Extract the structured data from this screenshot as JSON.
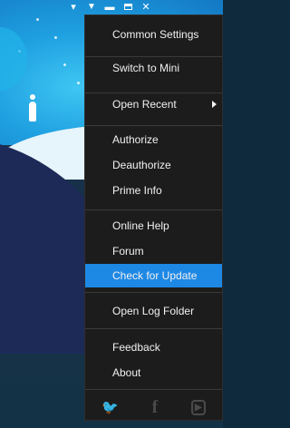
{
  "menu": {
    "items": [
      {
        "label": "Common Settings"
      },
      {
        "label": "Switch to Mini"
      },
      {
        "label": "Open Recent"
      },
      {
        "label": "Authorize"
      },
      {
        "label": "Deauthorize"
      },
      {
        "label": "Prime Info"
      },
      {
        "label": "Online Help"
      },
      {
        "label": "Forum"
      },
      {
        "label": "Check for Update"
      },
      {
        "label": "Open Log Folder"
      },
      {
        "label": "Feedback"
      },
      {
        "label": "About"
      }
    ],
    "selected_index": 8,
    "selected_color": "#1e88e5",
    "background_color": "#1c1c1c",
    "social_icons": [
      "twitter-icon",
      "facebook-icon",
      "youtube-icon"
    ]
  },
  "window_controls": [
    "menu-dropdown-icon",
    "minimize-icon",
    "restore-icon",
    "close-icon"
  ]
}
